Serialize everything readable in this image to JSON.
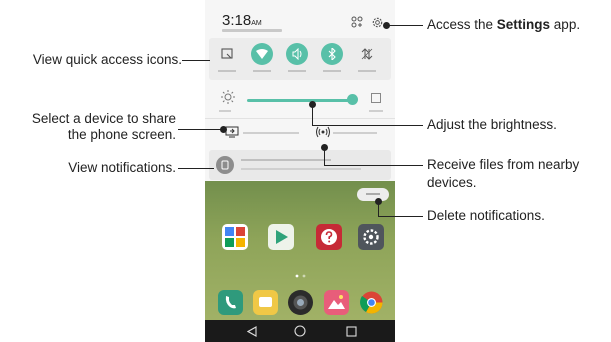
{
  "status_bar": {
    "clock": "3:18",
    "ampm": "AM"
  },
  "quick_access": {
    "items": [
      {
        "icon": "screen-icon",
        "on": false
      },
      {
        "icon": "wifi-icon",
        "on": true
      },
      {
        "icon": "sound-icon",
        "on": true
      },
      {
        "icon": "bluetooth-icon",
        "on": true
      },
      {
        "icon": "data-icon",
        "on": false
      }
    ]
  },
  "brightness": {
    "level": 0.9
  },
  "colors": {
    "accent": "#58c0a8",
    "panel": "#f6f6f6",
    "wallpaper": "#6b8a48"
  },
  "callouts": {
    "settings_prefix": "Access the ",
    "settings_bold": "Settings",
    "settings_suffix": " app.",
    "quick_access": "View quick access icons.",
    "share_line1": "Select a device to share",
    "share_line2": "the phone screen.",
    "notifications": "View notifications.",
    "brightness": "Adjust the brightness.",
    "receive_line1": "Receive files from nearby",
    "receive_line2": "devices.",
    "delete": "Delete notifications."
  },
  "nav": {
    "back": "◁",
    "home": "○",
    "recents": "☐"
  }
}
